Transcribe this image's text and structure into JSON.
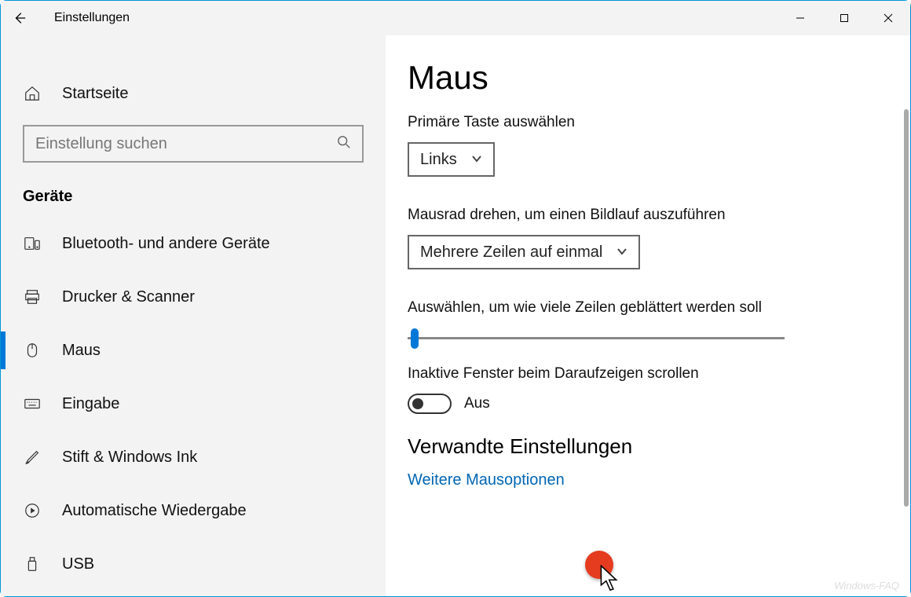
{
  "window": {
    "title": "Einstellungen"
  },
  "sidebar": {
    "home_label": "Startseite",
    "search_placeholder": "Einstellung suchen",
    "section_label": "Geräte",
    "items": [
      {
        "label": "Bluetooth- und andere Geräte"
      },
      {
        "label": "Drucker & Scanner"
      },
      {
        "label": "Maus"
      },
      {
        "label": "Eingabe"
      },
      {
        "label": "Stift & Windows Ink"
      },
      {
        "label": "Automatische Wiedergabe"
      },
      {
        "label": "USB"
      }
    ]
  },
  "page": {
    "heading": "Maus",
    "primary_button_label": "Primäre Taste auswählen",
    "primary_button_value": "Links",
    "wheel_scroll_label": "Mausrad drehen, um einen Bildlauf auszuführen",
    "wheel_scroll_value": "Mehrere Zeilen auf einmal",
    "lines_label": "Auswählen, um wie viele Zeilen geblättert werden soll",
    "inactive_label": "Inaktive Fenster beim Daraufzeigen scrollen",
    "inactive_state": "Aus",
    "related_heading": "Verwandte Einstellungen",
    "more_options_link": "Weitere Mausoptionen"
  },
  "watermark": "Windows-FAQ"
}
